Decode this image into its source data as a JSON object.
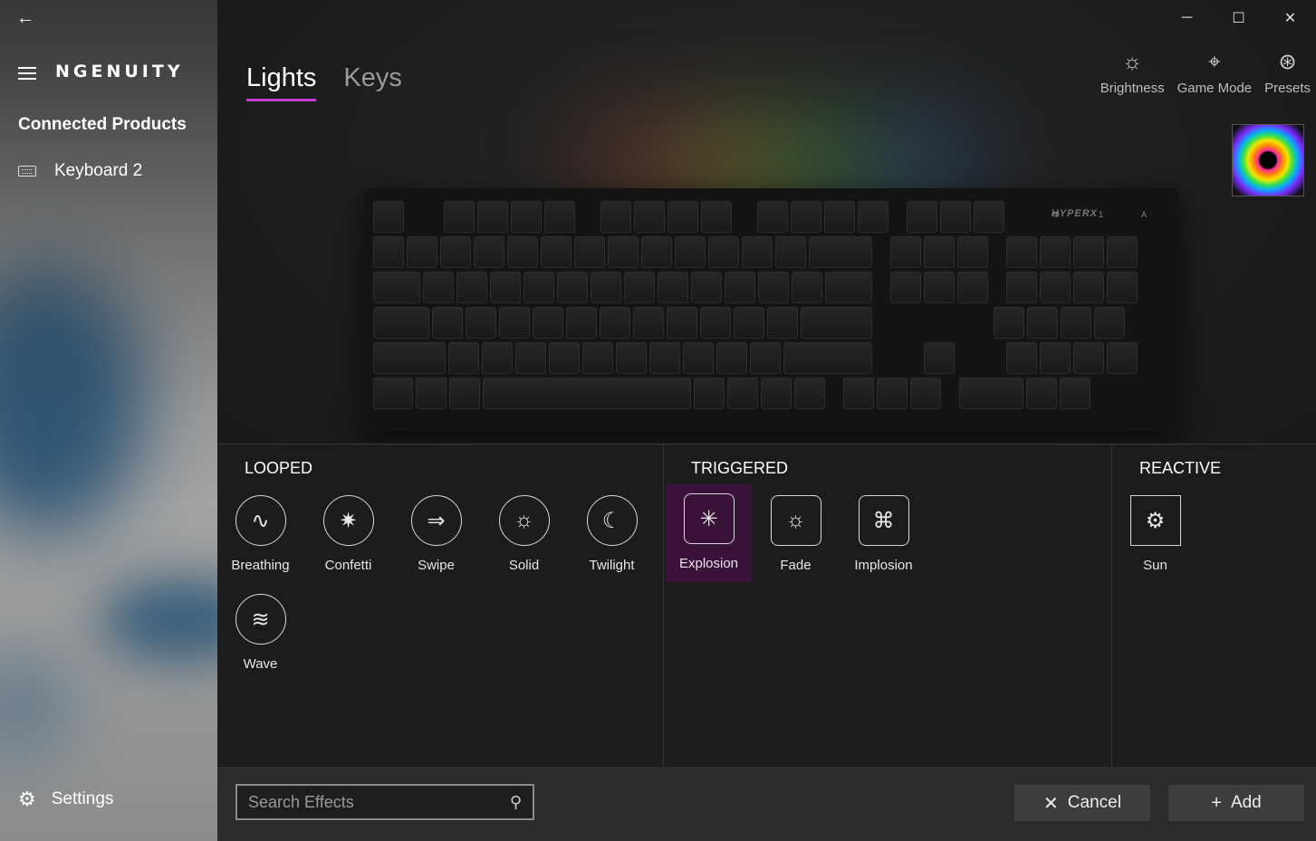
{
  "sidebar": {
    "back_icon": "arrow-left-icon",
    "brand": "NGENUITY",
    "section_title": "Connected Products",
    "device": {
      "label": "Keyboard 2",
      "icon": "keyboard-icon"
    },
    "settings": {
      "label": "Settings",
      "icon": "gear-icon"
    }
  },
  "tabs": [
    {
      "label": "Lights",
      "active": true
    },
    {
      "label": "Keys",
      "active": false
    }
  ],
  "window_controls": {
    "minimize": "─",
    "maximize": "☐",
    "close": "✕"
  },
  "toolbar": {
    "brightness": {
      "label": "Brightness",
      "icon": "sun-icon"
    },
    "game_mode": {
      "label": "Game Mode",
      "icon": "gamepad-icon"
    },
    "presets": {
      "label": "Presets",
      "icon": "circles-icon"
    }
  },
  "keyboard": {
    "logo": "HYPERX",
    "leds": "⚙ 1 A"
  },
  "effects": {
    "looped": {
      "title": "LOOPED",
      "items": [
        {
          "label": "Breathing",
          "icon": "wave-sine-icon"
        },
        {
          "label": "Confetti",
          "icon": "party-popper-icon"
        },
        {
          "label": "Swipe",
          "icon": "arrow-right-icon"
        },
        {
          "label": "Solid",
          "icon": "sun-icon"
        },
        {
          "label": "Twilight",
          "icon": "moon-stars-icon"
        },
        {
          "label": "Wave",
          "icon": "ocean-wave-icon"
        }
      ]
    },
    "triggered": {
      "title": "TRIGGERED",
      "items": [
        {
          "label": "Explosion",
          "icon": "burst-icon",
          "selected": true
        },
        {
          "label": "Fade",
          "icon": "sun-icon"
        },
        {
          "label": "Implosion",
          "icon": "implosion-icon"
        }
      ]
    },
    "reactive": {
      "title": "REACTIVE",
      "items": [
        {
          "label": "Sun",
          "icon": "gear-sun-icon"
        }
      ]
    }
  },
  "footer": {
    "search_placeholder": "Search Effects",
    "search_value": "",
    "cancel_label": "Cancel",
    "add_label": "Add"
  },
  "colors": {
    "accent": "#c13bd1",
    "selected_bg": "#3a1138"
  }
}
